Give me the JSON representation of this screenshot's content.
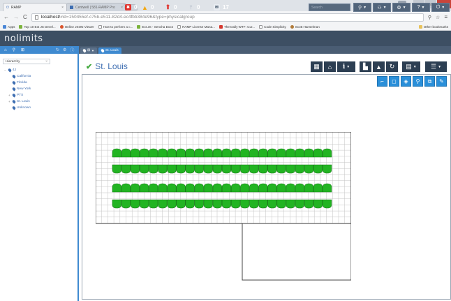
{
  "browser": {
    "tabs": [
      {
        "label": "RAMP",
        "active": true
      },
      {
        "label": "Centwell | 581-RAMP Pro",
        "active": false
      }
    ],
    "url_host": "localhost/",
    "url_rest": "#id=150455ef-c75b-e511-82d4-ec4fbb384e96&type=physicalgroup",
    "bookmarks": [
      "Apps",
      "Top 10 Ext JS Devel...",
      "Online JSON Viewer",
      "How to perform a c...",
      "Ext JS - Sencha Docs",
      "RAMP License Mana...",
      "The Daily WTF: Cur...",
      "Code Simplicity",
      "Scott Hanselman"
    ],
    "other_bookmarks": "Other bookmarks"
  },
  "app": {
    "logo": "nolimits",
    "stats": [
      {
        "name": "errors",
        "value": "0",
        "color": "#e0342e",
        "icon": "✖"
      },
      {
        "name": "warnings",
        "value": "0",
        "color": "#f2a60d",
        "icon": "▲"
      },
      {
        "name": "alerts",
        "value": "0",
        "color": "#e0342e",
        "icon": "⬆"
      },
      {
        "name": "hot",
        "value": "0",
        "color": "#9aa7b6",
        "icon": "🌡"
      },
      {
        "name": "messages",
        "value": "17",
        "color": "#e9edf2",
        "icon": "✉"
      }
    ],
    "search_placeholder": "Search",
    "breadcrumbs": [
      {
        "label": "",
        "active": false
      },
      {
        "label": "St. Louis",
        "active": true
      }
    ]
  },
  "sidebar": {
    "heading": "Hierarchy",
    "tree": [
      {
        "label": "4J",
        "level": 0,
        "expand": "−"
      },
      {
        "label": "California",
        "level": 1,
        "expand": ""
      },
      {
        "label": "Florida",
        "level": 1,
        "expand": ""
      },
      {
        "label": "New York",
        "level": 1,
        "expand": ""
      },
      {
        "label": "PTS",
        "level": 1,
        "expand": "+"
      },
      {
        "label": "St. Louis",
        "level": 1,
        "expand": "+"
      },
      {
        "label": "Unknown",
        "level": 1,
        "expand": ""
      }
    ]
  },
  "main": {
    "title": "St. Louis",
    "rack_color": "#22b422",
    "rack_rows": 4,
    "racks_per_row": 24
  }
}
